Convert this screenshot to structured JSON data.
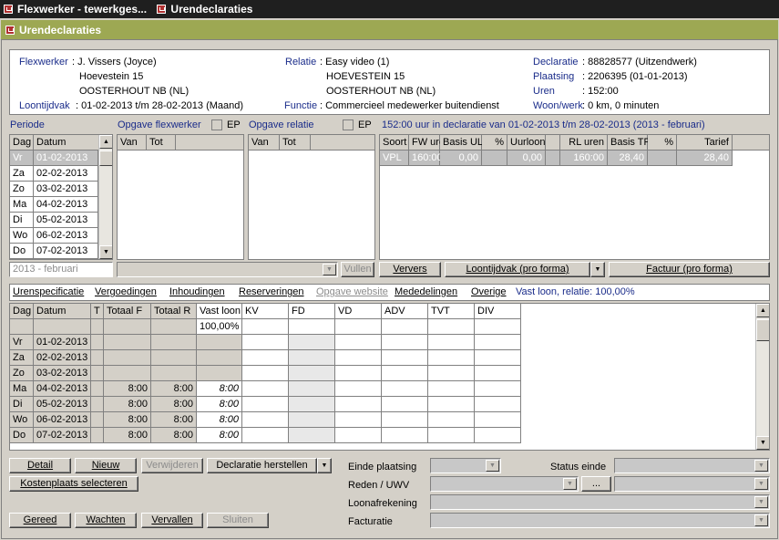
{
  "tabs": [
    {
      "label": "Flexwerker - tewerkges..."
    },
    {
      "label": "Urendeclaraties"
    }
  ],
  "window": {
    "title": "Urendeclaraties"
  },
  "info": {
    "flexwerker_label": "Flexwerker",
    "flexwerker": ": J. Vissers (Joyce)",
    "addr1": "Hoevestein 15",
    "addr2": "OOSTERHOUT NB (NL)",
    "loontijdvak_label": "Loontijdvak",
    "loontijdvak": ": 01-02-2013 t/m 28-02-2013 (Maand)",
    "relatie_label": "Relatie",
    "relatie": ": Easy video (1)",
    "raddr1": "HOEVESTEIN 15",
    "raddr2": "OOSTERHOUT NB (NL)",
    "functie_label": "Functie",
    "functie": ": Commercieel medewerker buitendienst",
    "declaratie_label": "Declaratie",
    "declaratie": ": 88828577 (Uitzendwerk)",
    "plaatsing_label": "Plaatsing",
    "plaatsing": ": 2206395   (01-01-2013)",
    "uren_label": "Uren",
    "uren": ": 152:00",
    "woonwerk_label": "Woon/werk",
    "woonwerk": ": 0 km, 0 minuten"
  },
  "periode": {
    "label": "Periode",
    "headers": [
      "Dag",
      "Datum"
    ],
    "rows": [
      [
        "Vr",
        "01-02-2013"
      ],
      [
        "Za",
        "02-02-2013"
      ],
      [
        "Zo",
        "03-02-2013"
      ],
      [
        "Ma",
        "04-02-2013"
      ],
      [
        "Di",
        "05-02-2013"
      ],
      [
        "Wo",
        "06-02-2013"
      ],
      [
        "Do",
        "07-02-2013"
      ]
    ],
    "month": "2013 - februari"
  },
  "opgave_flex": {
    "label": "Opgave flexwerker",
    "ep": "EP",
    "headers": [
      "Van",
      "Tot"
    ]
  },
  "opgave_relatie": {
    "label": "Opgave relatie",
    "ep": "EP",
    "headers": [
      "Van",
      "Tot"
    ]
  },
  "declaratie": {
    "summary": "152:00 uur in declaratie van 01-02-2013 t/m 28-02-2013 (2013 - februari)",
    "headers": [
      "Soort",
      "FW uren",
      "Basis UL",
      "%",
      "Uurloon",
      "",
      "RL uren",
      "Basis TR",
      "%",
      "Tarief"
    ],
    "row": [
      "VPL",
      "160:00",
      "0,00",
      "",
      "0,00",
      "",
      "160:00",
      "28,40",
      "",
      "28,40"
    ]
  },
  "buttons": {
    "vullen": "Vullen",
    "ververs": "Ververs",
    "loontijdvak": "Loontijdvak (pro forma)",
    "factuur": "Factuur (pro forma)",
    "detail": "Detail",
    "nieuw": "Nieuw",
    "verwijderen": "Verwijderen",
    "herstellen": "Declaratie herstellen",
    "kostenplaats": "Kostenplaats selecteren",
    "gereed": "Gereed",
    "wachten": "Wachten",
    "vervallen": "Vervallen",
    "sluiten": "Sluiten",
    "dots": "..."
  },
  "subtabs": [
    "Urenspecificatie",
    "Vergoedingen",
    "Inhoudingen",
    "Reserveringen",
    "Opgave website",
    "Mededelingen",
    "Overige"
  ],
  "vastloon_text": "Vast loon, relatie: 100,00%",
  "spec": {
    "headers": [
      "Dag",
      "Datum",
      "T",
      "Totaal F",
      "Totaal R",
      "Vast loon",
      "KV",
      "FD",
      "VD",
      "ADV",
      "TVT",
      "DIV"
    ],
    "subheader": "100,00%",
    "rows": [
      [
        "Vr",
        "01-02-2013",
        "",
        "",
        "",
        ""
      ],
      [
        "Za",
        "02-02-2013",
        "",
        "",
        "",
        ""
      ],
      [
        "Zo",
        "03-02-2013",
        "",
        "",
        "",
        ""
      ],
      [
        "Ma",
        "04-02-2013",
        "",
        "8:00",
        "8:00",
        "8:00"
      ],
      [
        "Di",
        "05-02-2013",
        "",
        "8:00",
        "8:00",
        "8:00"
      ],
      [
        "Wo",
        "06-02-2013",
        "",
        "8:00",
        "8:00",
        "8:00"
      ],
      [
        "Do",
        "07-02-2013",
        "",
        "8:00",
        "8:00",
        "8:00"
      ]
    ]
  },
  "form": {
    "einde_plaatsing": "Einde plaatsing",
    "status_einde": "Status einde",
    "reden": "Reden / UWV",
    "loonafrekening": "Loonafrekening",
    "facturatie": "Facturatie"
  }
}
